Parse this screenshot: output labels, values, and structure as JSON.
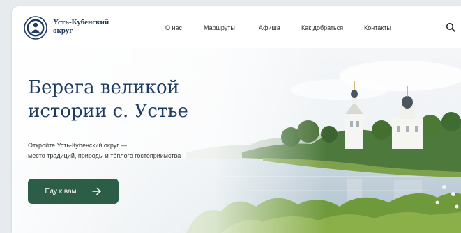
{
  "header": {
    "brand_line1": "Усть-Кубенский",
    "brand_line2": "округ",
    "nav": [
      {
        "label": "О нас"
      },
      {
        "label": "Маршруты"
      },
      {
        "label": "Афиша"
      },
      {
        "label": "Как добраться"
      },
      {
        "label": "Контакты"
      }
    ],
    "search_icon": "search-icon",
    "logo_icon": "emblem-logo"
  },
  "hero": {
    "title_line1": "Берега великой",
    "title_line2": "истории с. Устье",
    "subtitle_line1": "Откройте Усть-Кубенский округ —",
    "subtitle_line2": "место традиций, природы и тёплого гостеприимства",
    "cta_label": "Еду к вам",
    "cta_icon": "arrow-right-icon"
  },
  "colors": {
    "accent": "#2c5d47",
    "title": "#1d3a60",
    "brand": "#1f3a63"
  }
}
